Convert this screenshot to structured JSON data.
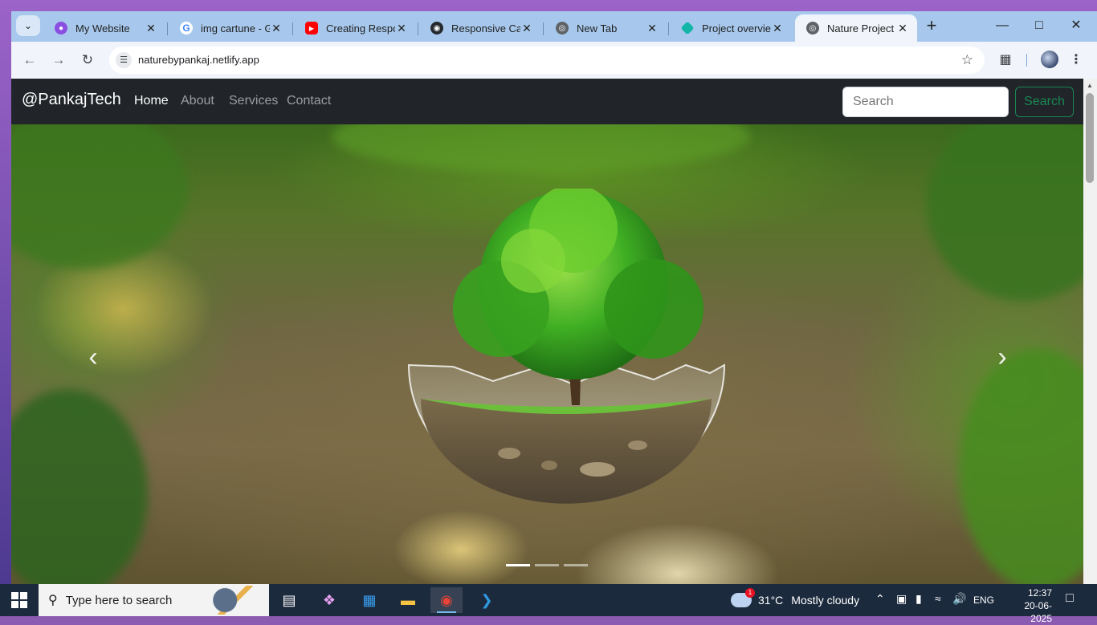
{
  "tabs": [
    {
      "title": "My Website",
      "favicon": "site-logo-icon",
      "color": "#8a4fe0"
    },
    {
      "title": "img cartune - Goo",
      "favicon": "google-icon",
      "color": "#4285f4"
    },
    {
      "title": "Creating Respon",
      "favicon": "youtube-icon",
      "color": "#ff0000"
    },
    {
      "title": "Responsive Card",
      "favicon": "github-icon",
      "color": "#24292f"
    },
    {
      "title": "New Tab",
      "favicon": "chrome-icon",
      "color": "#5f6368"
    },
    {
      "title": "Project overview",
      "favicon": "netlify-icon",
      "color": "#12b5a6"
    },
    {
      "title": "Nature Project",
      "favicon": "globe-icon",
      "color": "#5f6368",
      "active": true
    }
  ],
  "toolbar": {
    "url": "naturebypankaj.netlify.app"
  },
  "site": {
    "brand": "@PankajTech",
    "nav": [
      "Home",
      "About",
      "Services",
      "Contact"
    ],
    "search_placeholder": "Search",
    "search_button": "Search"
  },
  "carousel": {
    "slide_count": 3,
    "active_slide": 1,
    "prev_glyph": "‹",
    "next_glyph": "›"
  },
  "taskbar": {
    "search_placeholder": "Type here to search",
    "weather": {
      "temp": "31°C",
      "condition": "Mostly cloudy",
      "badge": "1"
    },
    "language": "ENG",
    "time": "12:37",
    "date": "20-06-2025"
  }
}
